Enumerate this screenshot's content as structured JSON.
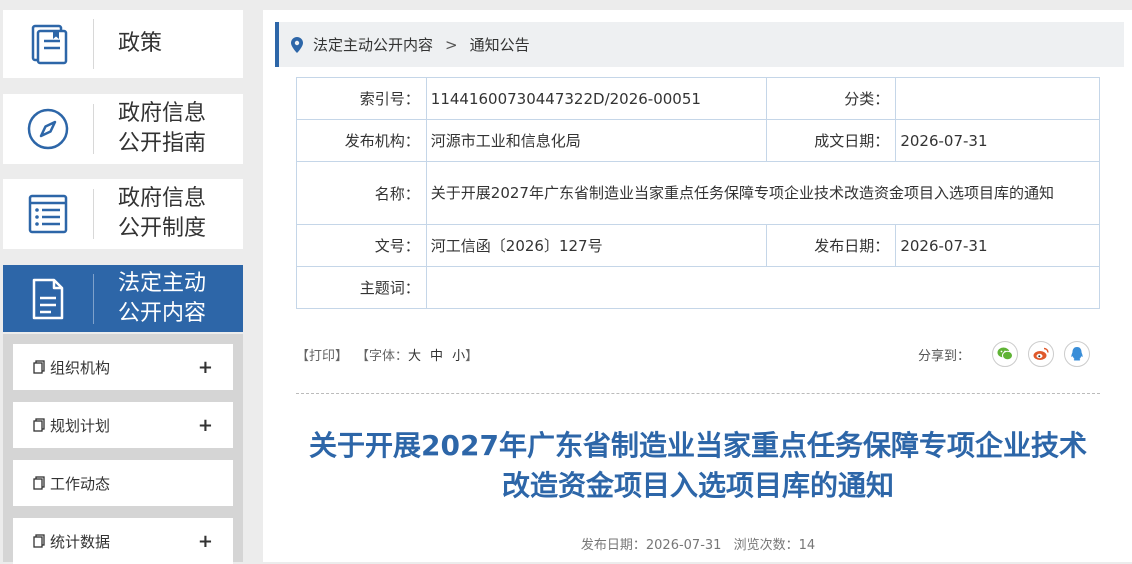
{
  "sidebar": {
    "nav": [
      {
        "label": "政策",
        "icon": "book-icon"
      },
      {
        "label_line1": "政府信息",
        "label_line2": "公开指南",
        "icon": "compass-icon"
      },
      {
        "label_line1": "政府信息",
        "label_line2": "公开制度",
        "icon": "list-icon"
      },
      {
        "label_line1": "法定主动",
        "label_line2": "公开内容",
        "icon": "document-icon"
      }
    ],
    "sub_items": [
      {
        "label": "组织机构",
        "expander": "+"
      },
      {
        "label": "规划计划",
        "expander": "+"
      },
      {
        "label": "工作动态"
      },
      {
        "label": "统计数据",
        "expander": "+"
      }
    ]
  },
  "breadcrumb": {
    "items": [
      "法定主动公开内容",
      "通知公告"
    ],
    "separator": ">"
  },
  "meta": {
    "index_no_label": "索引号：",
    "index_no": "11441600730447322D/2026-00051",
    "category_label": "分类：",
    "category": "",
    "publisher_label": "发布机构：",
    "publisher": "河源市工业和信息化局",
    "written_date_label": "成文日期：",
    "written_date": "2026-07-31",
    "name_label": "名称：",
    "name": "关于开展2027年广东省制造业当家重点任务保障专项企业技术改造资金项目入选项目库的通知",
    "doc_no_label": "文号：",
    "doc_no": "河工信函〔2026〕127号",
    "publish_date_label": "发布日期：",
    "publish_date": "2026-07-31",
    "keywords_label": "主题词：",
    "keywords": ""
  },
  "toolbar": {
    "print": "【打印】",
    "font_prefix": "【字体：",
    "font_large": "大",
    "font_medium": "中",
    "font_small": "小",
    "font_suffix": "】",
    "share_label": "分享到："
  },
  "article": {
    "title": "关于开展2027年广东省制造业当家重点任务保障专项企业技术改造资金项目入选项目库的通知",
    "publish_label": "发布日期：",
    "publish_date": "2026-07-31",
    "views_label": "浏览次数：",
    "views": "14"
  },
  "colors": {
    "accent": "#2d66a8",
    "wechat": "#5fb335",
    "weibo": "#e0592b",
    "qq": "#3a8ed8"
  }
}
